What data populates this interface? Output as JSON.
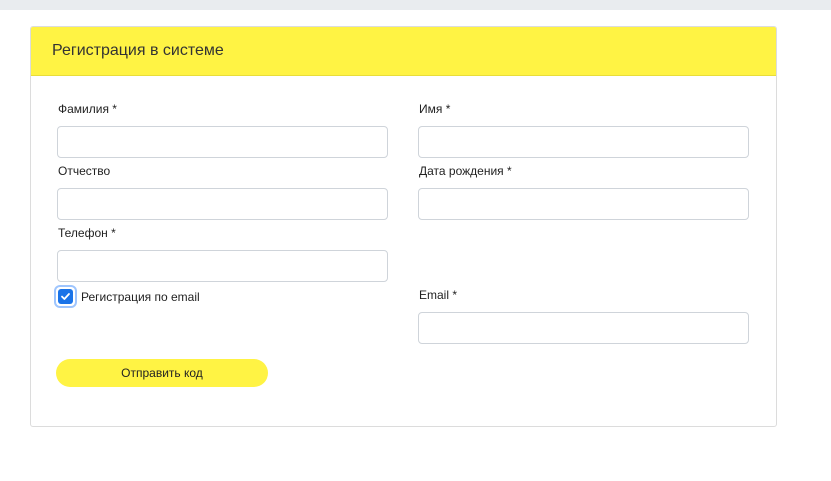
{
  "form": {
    "title": "Регистрация в системе",
    "fields": {
      "last_name": {
        "label": "Фамилия *",
        "value": ""
      },
      "first_name": {
        "label": "Имя *",
        "value": ""
      },
      "middle_name": {
        "label": "Отчество",
        "value": ""
      },
      "birth_date": {
        "label": "Дата рождения *",
        "value": ""
      },
      "phone": {
        "label": "Телефон *",
        "value": ""
      },
      "email": {
        "label": "Email *",
        "value": ""
      }
    },
    "email_checkbox": {
      "label": "Регистрация по email",
      "checked": true
    },
    "submit_label": "Отправить код"
  },
  "colors": {
    "accent": "#fff344",
    "checkbox": "#1a73e8"
  }
}
